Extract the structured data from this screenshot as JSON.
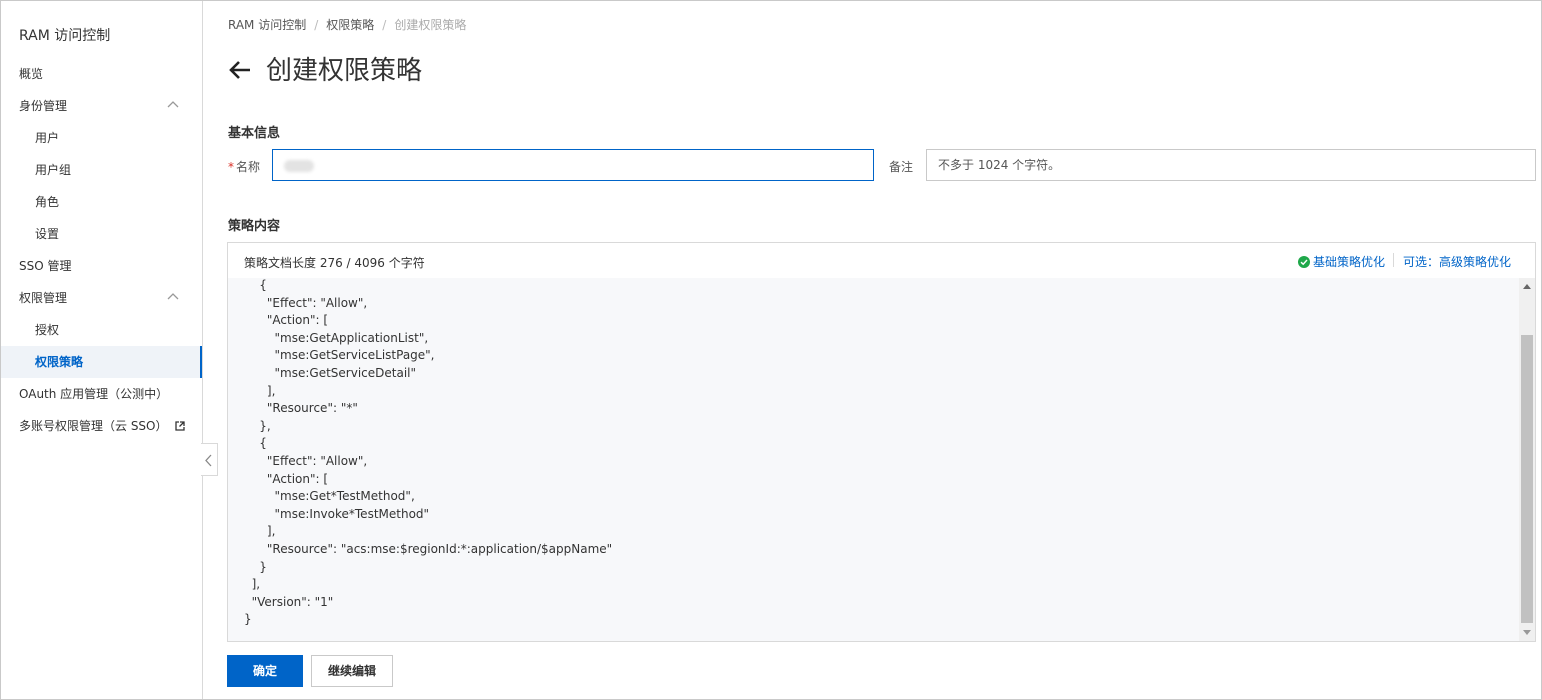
{
  "sidebar": {
    "title": "RAM 访问控制",
    "items": [
      {
        "label": "概览"
      },
      {
        "label": "身份管理"
      },
      {
        "label": "用户"
      },
      {
        "label": "用户组"
      },
      {
        "label": "角色"
      },
      {
        "label": "设置"
      },
      {
        "label": "SSO 管理"
      },
      {
        "label": "权限管理"
      },
      {
        "label": "授权"
      },
      {
        "label": "权限策略"
      },
      {
        "label": "OAuth 应用管理（公测中）"
      },
      {
        "label": "多账号权限管理（云 SSO）"
      }
    ]
  },
  "breadcrumb": [
    "RAM 访问控制",
    "权限策略",
    "创建权限策略"
  ],
  "page_title": "创建权限策略",
  "basic_info": {
    "section_title": "基本信息",
    "name_label": "名称",
    "required_mark": "*",
    "note_label": "备注",
    "note_placeholder": "不多于 1024 个字符。"
  },
  "policy": {
    "section_title": "策略内容",
    "doc_length": "策略文档长度 276 / 4096 个字符",
    "basic_optimize": "基础策略优化",
    "advanced_optimize": "可选：高级策略优化",
    "code_lines": [
      "    {",
      "      \"Effect\": \"Allow\",",
      "      \"Action\": [",
      "        \"mse:GetApplicationList\",",
      "        \"mse:GetServiceListPage\",",
      "        \"mse:GetServiceDetail\"",
      "      ],",
      "      \"Resource\": \"*\"",
      "    },",
      "    {",
      "      \"Effect\": \"Allow\",",
      "      \"Action\": [",
      "        \"mse:Get*TestMethod\",",
      "        \"mse:Invoke*TestMethod\"",
      "      ],",
      "      \"Resource\": \"acs:mse:$regionId:*:application/$appName\"",
      "    }",
      "  ],",
      "  \"Version\": \"1\"",
      "}"
    ]
  },
  "actions": {
    "confirm": "确定",
    "continue_edit": "继续编辑"
  },
  "colors": {
    "primary": "#0064c8",
    "success": "#1fa84a",
    "required": "#d93026"
  }
}
